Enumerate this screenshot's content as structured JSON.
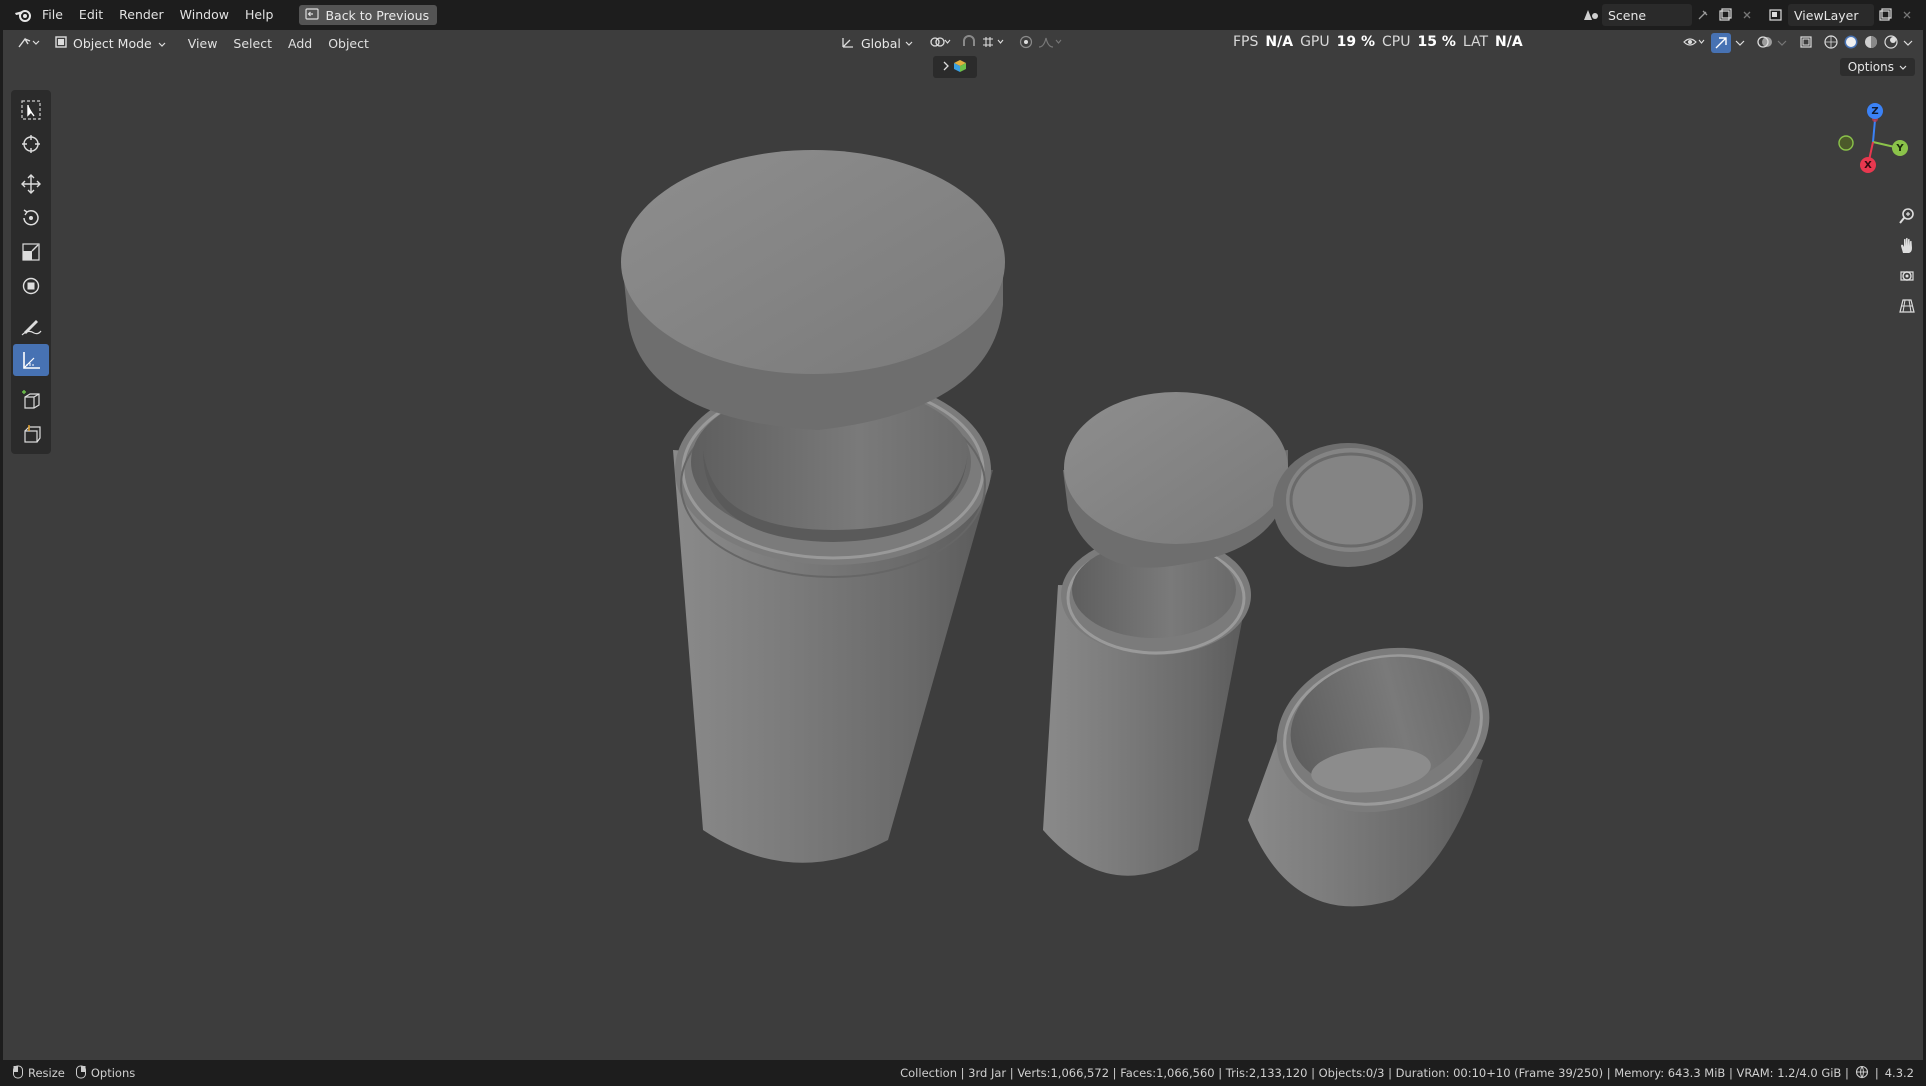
{
  "menu": {
    "items": [
      "File",
      "Edit",
      "Render",
      "Window",
      "Help"
    ],
    "back_button": "Back to Previous"
  },
  "topbar_right": {
    "scene": "Scene",
    "view_layer": "ViewLayer"
  },
  "viewport_header": {
    "mode": "Object Mode",
    "menus": [
      "View",
      "Select",
      "Add",
      "Object"
    ],
    "orientation": "Global",
    "options": "Options"
  },
  "perf": {
    "fps_label": "FPS",
    "fps_value": "N/A",
    "gpu_label": "GPU",
    "gpu_value": "19 %",
    "cpu_label": "CPU",
    "cpu_value": "15 %",
    "lat_label": "LAT",
    "lat_value": "N/A"
  },
  "nav_gizmo": {
    "z": "Z",
    "y": "Y",
    "x": "X"
  },
  "statusbar": {
    "resize": "Resize",
    "options": "Options",
    "stats": "Collection | 3rd Jar | Verts:1,066,572 | Faces:1,066,560 | Tris:2,133,120 | Objects:0/3 | Duration: 00:10+10 (Frame 39/250) | Memory: 643.3 MiB | VRAM: 1.2/4.0 GiB |",
    "version": "4.3.2"
  },
  "colors": {
    "accent": "#4772b3",
    "viewport_bg": "#3d3d3d",
    "axis_x": "#e8384f",
    "axis_y": "#8bc34a",
    "axis_z": "#3b82f6"
  }
}
